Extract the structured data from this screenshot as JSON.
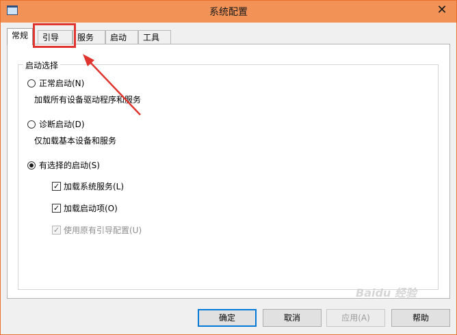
{
  "window": {
    "title": "系统配置",
    "close_symbol": "✕"
  },
  "tabs": [
    {
      "label": "常规"
    },
    {
      "label": "引导"
    },
    {
      "label": "服务"
    },
    {
      "label": "启动"
    },
    {
      "label": "工具"
    }
  ],
  "active_tab": "常规",
  "startup_group": {
    "legend": "启动选择",
    "options": [
      {
        "label": "正常启动(N)",
        "description": "加载所有设备驱动程序和服务",
        "selected": false
      },
      {
        "label": "诊断启动(D)",
        "description": "仅加载基本设备和服务",
        "selected": false
      },
      {
        "label": "有选择的启动(S)",
        "selected": true
      }
    ],
    "checkboxes": [
      {
        "label": "加载系统服务(L)",
        "checked": true,
        "enabled": true
      },
      {
        "label": "加载启动项(O)",
        "checked": true,
        "enabled": true
      },
      {
        "label": "使用原有引导配置(U)",
        "checked": true,
        "enabled": false
      }
    ]
  },
  "buttons": {
    "ok": "确定",
    "cancel": "取消",
    "apply": "应用(A)",
    "help": "帮助"
  },
  "colors": {
    "titlebar": "#f29257",
    "annotation_red": "#e0342e",
    "default_button_border": "#0078d7"
  },
  "watermark": "Baidu 经验"
}
